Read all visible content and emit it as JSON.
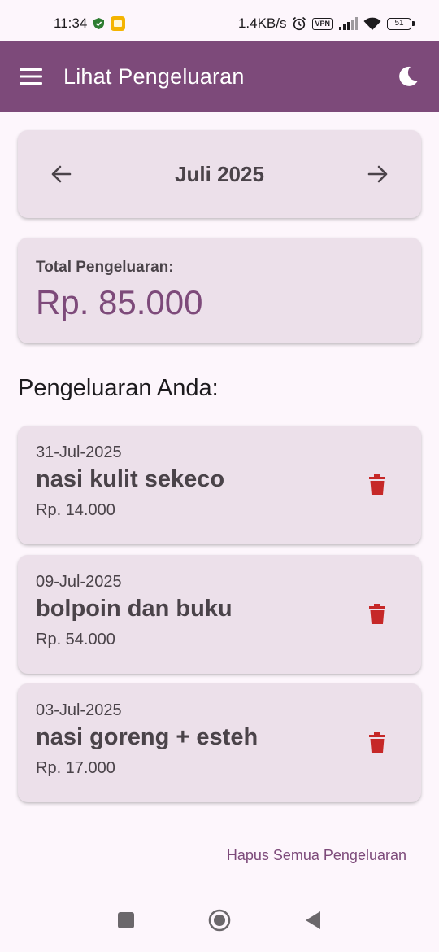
{
  "status_bar": {
    "time": "11:34",
    "speed": "1.4KB/s",
    "vpn": "VPN",
    "battery": "51"
  },
  "app_bar": {
    "title": "Lihat Pengeluaran",
    "menu_icon": "menu-icon",
    "theme_icon": "moon-icon"
  },
  "month_nav": {
    "label": "Juli 2025",
    "prev_icon": "arrow-left-icon",
    "next_icon": "arrow-right-icon"
  },
  "total": {
    "label": "Total Pengeluaran:",
    "value": "Rp. 85.000"
  },
  "section_title": "Pengeluaran Anda:",
  "expenses": [
    {
      "date": "31-Jul-2025",
      "name": "nasi kulit sekeco",
      "amount": "Rp. 14.000"
    },
    {
      "date": "09-Jul-2025",
      "name": "bolpoin dan buku",
      "amount": "Rp. 54.000"
    },
    {
      "date": "03-Jul-2025",
      "name": "nasi goreng + esteh",
      "amount": "Rp. 17.000"
    }
  ],
  "clear_all_label": "Hapus Semua Pengeluaran",
  "colors": {
    "primary": "#7d4a7a",
    "card": "#ece0ea",
    "background": "#fdf6fc",
    "delete": "#c62828"
  }
}
